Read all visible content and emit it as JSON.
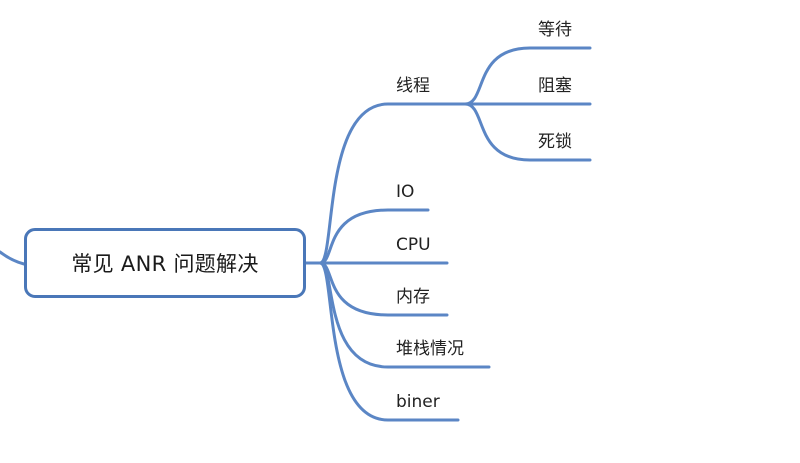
{
  "mindmap": {
    "root": "常见 ANR 问题解决",
    "branches": [
      {
        "label": "线程",
        "children": [
          "等待",
          "阻塞",
          "死锁"
        ]
      },
      {
        "label": "IO",
        "children": []
      },
      {
        "label": "CPU",
        "children": []
      },
      {
        "label": "内存",
        "children": []
      },
      {
        "label": "堆栈情况",
        "children": []
      },
      {
        "label": "biner",
        "children": []
      }
    ]
  },
  "colors": {
    "line": "#5b86c5",
    "root_border": "#4a77b8",
    "text": "#222222"
  }
}
